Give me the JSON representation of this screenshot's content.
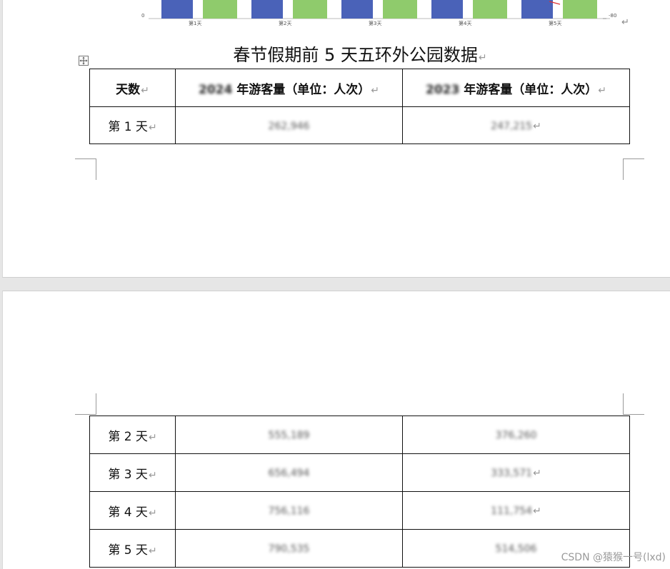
{
  "chart_remnant": {
    "tick_labels": [
      "第1天",
      "第2天",
      "第3天",
      "第4天",
      "第5天"
    ],
    "left_axis_zero": "0",
    "right_axis_label": "-80",
    "bar_colors": [
      "#4a62b8",
      "#8fcb6c"
    ]
  },
  "document": {
    "title": "春节假期前 5 天五环外公园数据",
    "paragraph_mark": "↵",
    "table": {
      "headers": [
        "天数",
        "2024 年游客量（单位：人次）",
        "2023 年游客量（单位：人次）"
      ],
      "header_year_1": "2024",
      "header_year_2": "2023",
      "header_suffix": " 年游客量（单位：人次）",
      "rows": [
        {
          "day": "第 1 天",
          "v2024": "262,946",
          "v2023": "247,215"
        },
        {
          "day": "第 2 天",
          "v2024": "555,189",
          "v2023": "376,260"
        },
        {
          "day": "第 3 天",
          "v2024": "656,494",
          "v2023": "333,571"
        },
        {
          "day": "第 4 天",
          "v2024": "756,116",
          "v2023": "111,754"
        },
        {
          "day": "第 5 天",
          "v2024": "790,535",
          "v2023": "514,506"
        }
      ]
    }
  },
  "watermark": "CSDN @猿猴一号(lxd)"
}
